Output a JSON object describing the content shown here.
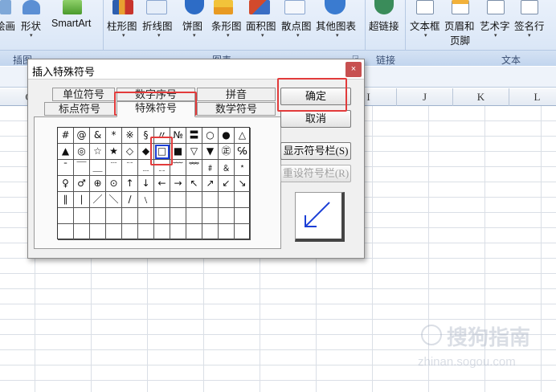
{
  "ribbon": {
    "items": [
      {
        "label": "绘画",
        "icon": "clip-art-icon"
      },
      {
        "label": "形状",
        "icon": "shapes-icon",
        "sub": "▾"
      },
      {
        "label": "SmartArt",
        "icon": "smartart-icon"
      },
      {
        "label": "柱形图",
        "icon": "column-chart-icon",
        "sub": "▾"
      },
      {
        "label": "折线图",
        "icon": "line-chart-icon",
        "sub": "▾"
      },
      {
        "label": "饼图",
        "icon": "pie-chart-icon",
        "sub": "▾"
      },
      {
        "label": "条形图",
        "icon": "bar-chart-icon",
        "sub": "▾"
      },
      {
        "label": "面积图",
        "icon": "area-chart-icon",
        "sub": "▾"
      },
      {
        "label": "散点图",
        "icon": "scatter-chart-icon",
        "sub": "▾"
      },
      {
        "label": "其他图表",
        "icon": "other-charts-icon",
        "sub": "▾"
      },
      {
        "label": "超链接",
        "icon": "hyperlink-icon"
      },
      {
        "label": "文本框",
        "icon": "textbox-icon",
        "sub": "▾"
      },
      {
        "label": "页眉和",
        "label2": "页脚",
        "icon": "header-footer-icon"
      },
      {
        "label": "艺术字",
        "icon": "wordart-icon",
        "sub": "▾"
      },
      {
        "label": "签名行",
        "icon": "signature-line-icon",
        "sub": "▾"
      }
    ],
    "groups": [
      {
        "label": "插图"
      },
      {
        "label": "图表"
      },
      {
        "label": "链接"
      },
      {
        "label": "文本"
      }
    ]
  },
  "sheet": {
    "columns": [
      "C",
      "I",
      "J",
      "K",
      "L"
    ]
  },
  "dialog": {
    "title": "插入特殊符号",
    "close": "×",
    "tabs_back": [
      "单位符号",
      "数字序号",
      "拼音"
    ],
    "tabs_front": [
      "标点符号",
      "特殊符号",
      "数学符号"
    ],
    "active_tab": "特殊符号",
    "symbols": [
      [
        "#",
        "@",
        "&",
        "*",
        "※",
        "§",
        "〃",
        "№",
        "〓",
        "○",
        "●",
        "△"
      ],
      [
        "▲",
        "◎",
        "☆",
        "★",
        "◇",
        "◆",
        "□",
        "■",
        "▽",
        "▼",
        "㊣",
        "℅"
      ],
      [
        "ˉ",
        "￣",
        "＿",
        "﹉",
        "﹊",
        "﹍",
        "﹎",
        "﹋",
        "﹌",
        "﹟",
        "﹠",
        "﹡"
      ],
      [
        "♀",
        "♂",
        "⊕",
        "⊙",
        "↑",
        "↓",
        "←",
        "→",
        "↖",
        "↗",
        "↙",
        "↘"
      ],
      [
        "∥",
        "∣",
        "／",
        "＼",
        "∕",
        "﹨",
        "",
        "",
        "",
        "",
        "",
        ""
      ],
      [
        "",
        "",
        "",
        "",
        "",
        "",
        "",
        "",
        "",
        "",
        "",
        ""
      ],
      [
        "",
        "",
        "",
        "",
        "",
        "",
        "",
        "",
        "",
        "",
        "",
        ""
      ]
    ],
    "selected": {
      "row": 1,
      "col": 6
    },
    "buttons": {
      "ok": "确定",
      "cancel": "取消",
      "show_bar": "显示符号栏(S)",
      "reset_bar": "重设符号栏(R)"
    },
    "preview_icon": "arrow-down-left-icon"
  },
  "watermark": {
    "brand": "搜狗指南",
    "url": "zhinan.sogou.com"
  },
  "colors": {
    "highlight": "#e23b3b",
    "selection": "#1b3fd6",
    "close_button": "#c75050"
  }
}
